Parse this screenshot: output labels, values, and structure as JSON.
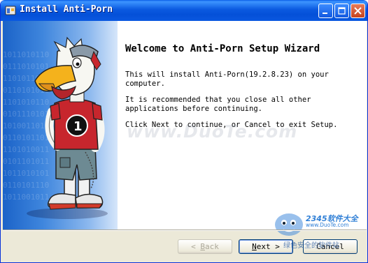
{
  "window": {
    "title": "Install Anti-Porn",
    "icon": "installer-icon",
    "controls": [
      "minimize",
      "maximize",
      "close"
    ]
  },
  "side_panel": {
    "binary_lines": [
      "1011010110",
      "0111010101",
      "1101011010",
      "0110101011",
      "1101010110",
      "0101110101",
      "1010011010",
      "0110101101",
      "1101010011",
      "0101101011",
      "1011010101",
      "0110101110",
      "1011001011"
    ]
  },
  "main": {
    "heading": "Welcome to Anti-Porn Setup Wizard",
    "para1": "This will install Anti-Porn(19.2.8.23) on your computer.",
    "para2": "It is recommended that you close all other applications before continuing.",
    "para3": "Click Next to continue, or Cancel to exit Setup."
  },
  "watermark": "www.DuoTe.com",
  "buttons": {
    "back": {
      "accel": "B",
      "rest": "ack",
      "prefix": "< ",
      "enabled": false
    },
    "next": {
      "accel": "N",
      "rest": "ext",
      "suffix": " >",
      "enabled": true
    },
    "cancel": {
      "label": "Cancel",
      "enabled": true
    }
  },
  "logo": {
    "brand": "2345软件大全",
    "url": "www.DuoTe.com",
    "bottom": "绿色安全的软件站"
  },
  "colors": {
    "title_blue": "#0450d8",
    "panel_blue": "#3f86dd",
    "dialog_bg": "#ece9d8"
  }
}
